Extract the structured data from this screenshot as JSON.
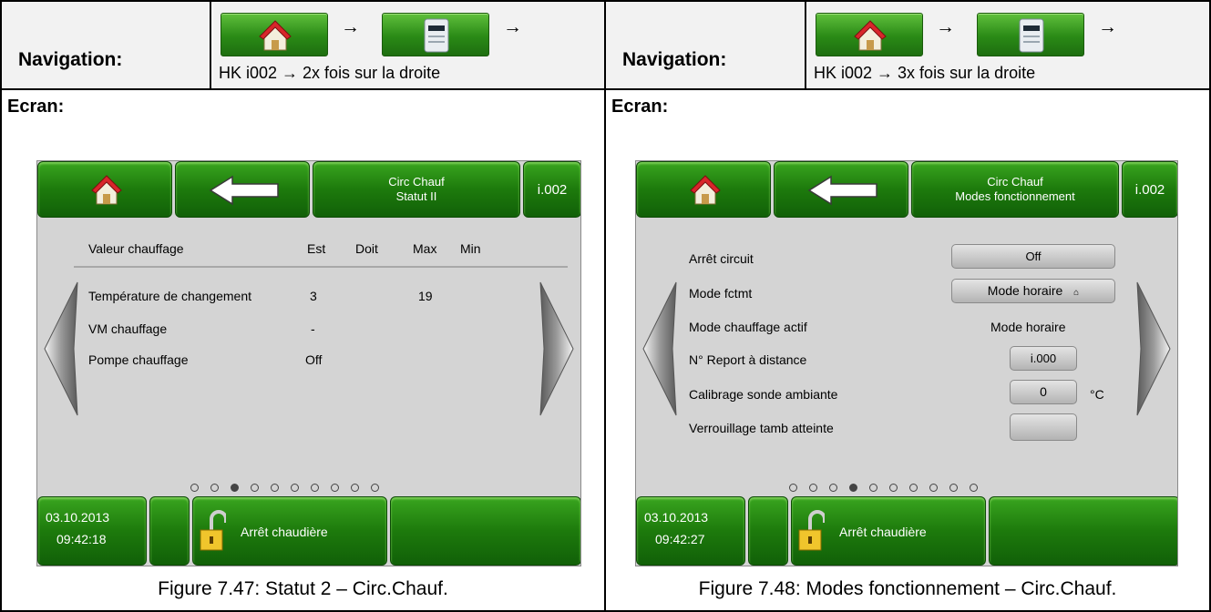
{
  "panels": [
    {
      "nav_label": "Navigation:",
      "nav_text": "HK i002 → 2x fois sur la droite",
      "nav_arrow": "→",
      "ecran_label": "Ecran:",
      "screen": {
        "title_line1": "Circ Chauf",
        "title_line2": "Statut II",
        "code": "i.002",
        "header": {
          "label": "Valeur chauffage",
          "col1": "Est",
          "col2": "Doit",
          "col3": "Max",
          "col4": "Min"
        },
        "rows": [
          {
            "label": "Température de changement",
            "est": "3",
            "max": "19"
          },
          {
            "label": "VM chauffage",
            "est": "-",
            "max": ""
          },
          {
            "label": "Pompe chauffage",
            "est": "Off",
            "max": ""
          }
        ],
        "dots_total": 10,
        "dots_active": 3,
        "date": "03.10.2013",
        "time": "09:42:18",
        "status": "Arrêt chaudière"
      },
      "caption": "Figure 7.47: Statut 2 – Circ.Chauf."
    },
    {
      "nav_label": "Navigation:",
      "nav_text": "HK i002 → 3x fois sur la droite",
      "nav_arrow": "→",
      "ecran_label": "Ecran:",
      "screen": {
        "title_line1": "Circ Chauf",
        "title_line2": "Modes fonctionnement",
        "code": "i.002",
        "settings": [
          {
            "label": "Arrêt circuit",
            "value": "Off"
          },
          {
            "label": "Mode fctmt",
            "value": "Mode horaire"
          },
          {
            "label": "Mode chauffage actif",
            "value": "Mode horaire"
          },
          {
            "label": "N°  Report à distance",
            "value": "i.000"
          },
          {
            "label": "Calibrage sonde ambiante",
            "value": "0",
            "unit": "°C"
          },
          {
            "label": "Verrouillage tamb atteinte",
            "value": ""
          }
        ],
        "dots_total": 10,
        "dots_active": 4,
        "date": "03.10.2013",
        "time": "09:42:27",
        "status": "Arrêt chaudière"
      },
      "caption": "Figure 7.48: Modes fonctionnement – Circ.Chauf."
    }
  ],
  "icons": {
    "home": "house-icon",
    "back": "arrow-left-icon",
    "module": "heating-module-icon",
    "lock": "padlock-open-icon",
    "prev": "chevron-left-icon",
    "next": "chevron-right-icon"
  }
}
